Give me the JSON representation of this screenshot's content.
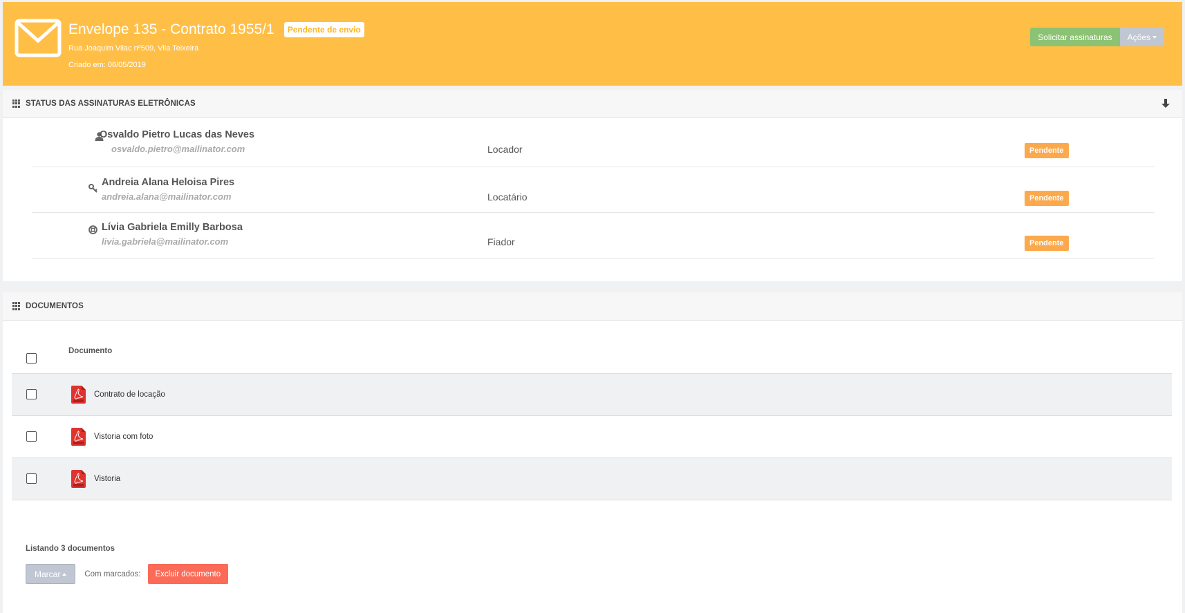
{
  "header": {
    "title": "Envelope 135 - Contrato 1955/1",
    "status_badge": "Pendente de envio",
    "address": "Rua Joaquim Vilac nº509, Vila Teixeira",
    "created": "Criado em: 06/05/2019",
    "request_button": "Solicitar assinaturas",
    "actions_button": "Ações",
    "icon": "envelope-icon",
    "color": "#ffbf47"
  },
  "signatures_panel": {
    "title": "STATUS DAS ASSINATURAS ELETRÔNICAS",
    "signers": [
      {
        "icon": "user-icon",
        "name": "Osvaldo Pietro Lucas das Neves",
        "email": "osvaldo.pietro@mailinator.com",
        "role": "Locador",
        "status": "Pendente"
      },
      {
        "icon": "key-icon",
        "name": "Andreia Alana Heloisa Pires",
        "email": "andreia.alana@mailinator.com",
        "role": "Locatário",
        "status": "Pendente"
      },
      {
        "icon": "lifebuoy-icon",
        "name": "Lívia Gabriela Emilly Barbosa",
        "email": "livia.gabriela@mailinator.com",
        "role": "Fiador",
        "status": "Pendente"
      }
    ]
  },
  "documents_panel": {
    "title": "DOCUMENTOS",
    "column_header": "Documento",
    "documents": [
      {
        "name": "Contrato de locação",
        "icon": "pdf-icon"
      },
      {
        "name": "Vistoria com foto",
        "icon": "pdf-icon"
      },
      {
        "name": "Vistoria",
        "icon": "pdf-icon"
      }
    ],
    "listing_text": "Listando 3 documentos",
    "mark_button": "Marcar",
    "with_marked_label": "Com marcados:",
    "delete_button": "Excluir documento"
  }
}
